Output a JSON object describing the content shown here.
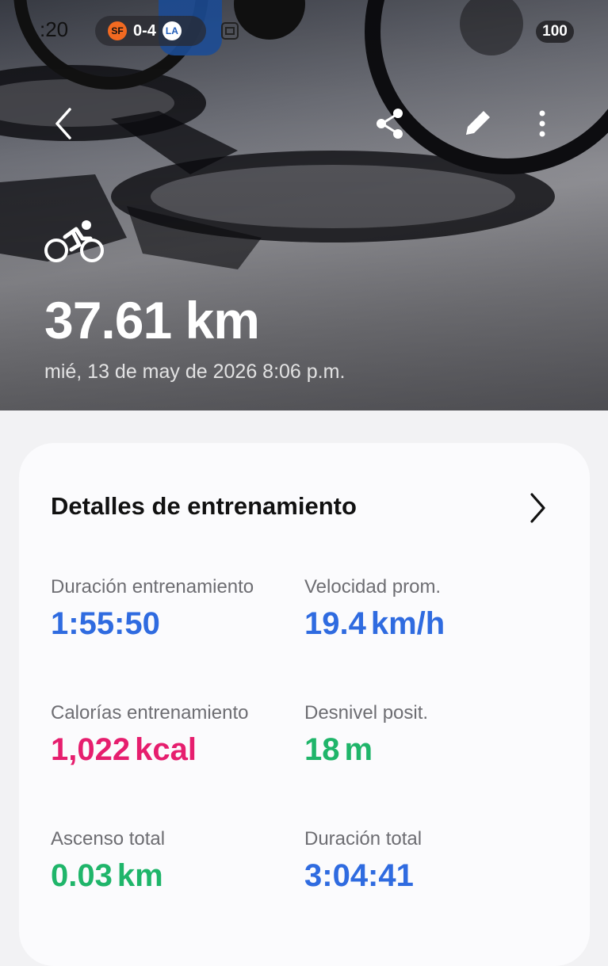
{
  "status_bar": {
    "time": ":20",
    "score": "0-4",
    "home_team_logo": "SF",
    "away_team_logo": "LA",
    "battery": "100"
  },
  "header": {
    "icons": [
      "back-icon",
      "share-icon",
      "edit-icon",
      "more-icon"
    ]
  },
  "workout": {
    "activity_icon": "cycling-icon",
    "distance": "37.61 km",
    "datetime": "mié, 13 de may de 2026 8:06 p.m."
  },
  "details": {
    "title": "Detalles de entrenamiento",
    "stats": [
      {
        "label": "Duración entrenamiento",
        "value": "1:55:50",
        "unit": "",
        "color": "#2f6be0"
      },
      {
        "label": "Velocidad prom.",
        "value": "19.4",
        "unit": "km/h",
        "color": "#2f6be0"
      },
      {
        "label": "Calorías entrenamiento",
        "value": "1,022",
        "unit": "kcal",
        "color": "#e61e6e"
      },
      {
        "label": "Desnivel posit.",
        "value": "18",
        "unit": "m",
        "color": "#1fb56a"
      },
      {
        "label": "Ascenso total",
        "value": "0.03",
        "unit": "km",
        "color": "#1fb56a"
      },
      {
        "label": "Duración total",
        "value": "3:04:41",
        "unit": "",
        "color": "#2f6be0"
      }
    ]
  }
}
